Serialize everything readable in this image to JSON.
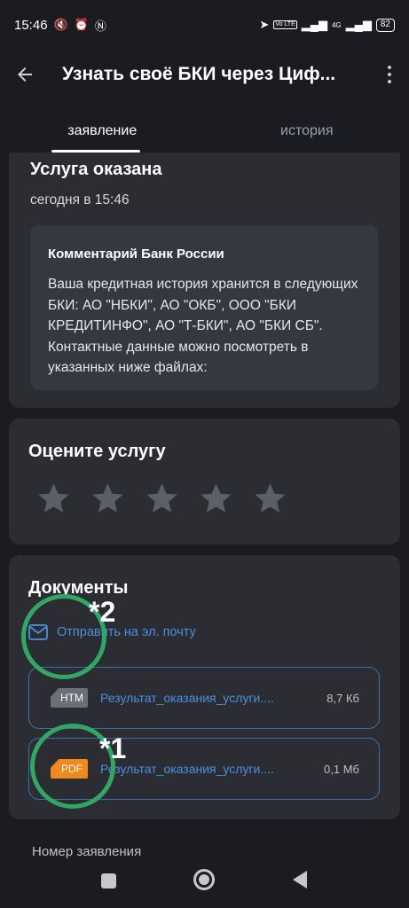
{
  "status_bar": {
    "time": "15:46",
    "battery": "82",
    "network": "4G",
    "volte": "Vo LTE"
  },
  "header": {
    "title": "Узнать своё БКИ через Циф..."
  },
  "tabs": [
    {
      "label": "заявление",
      "active": true
    },
    {
      "label": "история",
      "active": false
    }
  ],
  "service": {
    "title": "Услуга оказана",
    "date": "сегодня в 15:46",
    "comment_title": "Комментарий Банк России",
    "comment_text": "Ваша кредитная история хранится в следующих БКИ: АО \"НБКИ\", АО \"ОКБ\", ООО \"БКИ КРЕДИТИНФО\", АО \"Т-БКИ\", АО \"БКИ СБ\". Контактные данные можно посмотреть в указанных ниже файлах:"
  },
  "rating": {
    "title": "Оцените услугу",
    "stars": 5,
    "selected": 0
  },
  "documents": {
    "title": "Документы",
    "send_email": "Отправить на эл. почту",
    "files": [
      {
        "type": "HTM",
        "name": "Результат_оказания_услуги....",
        "size": "8,7 Кб",
        "color": "#6b6f76"
      },
      {
        "type": "PDF",
        "name": "Результат_оказания_услуги....",
        "size": "0,1 Мб",
        "color": "#f08a1c"
      }
    ]
  },
  "annotations": {
    "mark1": "*1",
    "mark2": "*2",
    "circle_color": "#2ea862"
  },
  "footer_label": "Номер заявления",
  "colors": {
    "background": "#1a1c21",
    "card": "#2b2d33",
    "accent": "#4a90e2"
  }
}
